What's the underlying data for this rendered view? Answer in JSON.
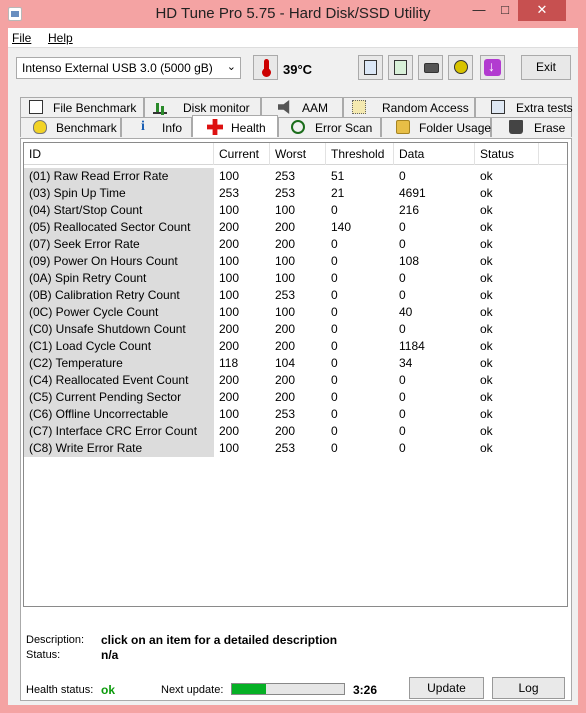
{
  "window": {
    "title": "HD Tune Pro 5.75 - Hard Disk/SSD Utility"
  },
  "menu": {
    "file": "File",
    "help": "Help"
  },
  "toolbar": {
    "drive": "Intenso External USB 3.0 (5000 gB)",
    "temperature": "39°C",
    "exit_label": "Exit"
  },
  "tabs_top": [
    {
      "label": "File Benchmark",
      "icon": "document-icon"
    },
    {
      "label": "Disk monitor",
      "icon": "bar-chart-icon"
    },
    {
      "label": "AAM",
      "icon": "speaker-icon"
    },
    {
      "label": "Random Access",
      "icon": "grid-icon"
    },
    {
      "label": "Extra tests",
      "icon": "table-icon"
    }
  ],
  "tabs_bottom": [
    {
      "label": "Benchmark",
      "icon": "bulb-icon"
    },
    {
      "label": "Info",
      "icon": "info-icon"
    },
    {
      "label": "Health",
      "icon": "health-cross-icon",
      "active": true
    },
    {
      "label": "Error Scan",
      "icon": "magnifier-icon"
    },
    {
      "label": "Folder Usage",
      "icon": "folder-icon"
    },
    {
      "label": "Erase",
      "icon": "trash-icon"
    }
  ],
  "smart_table": {
    "columns": [
      "ID",
      "Current",
      "Worst",
      "Threshold",
      "Data",
      "Status"
    ],
    "rows": [
      [
        "(01) Raw Read Error Rate",
        "100",
        "253",
        "51",
        "0",
        "ok"
      ],
      [
        "(03) Spin Up Time",
        "253",
        "253",
        "21",
        "4691",
        "ok"
      ],
      [
        "(04) Start/Stop Count",
        "100",
        "100",
        "0",
        "216",
        "ok"
      ],
      [
        "(05) Reallocated Sector Count",
        "200",
        "200",
        "140",
        "0",
        "ok"
      ],
      [
        "(07) Seek Error Rate",
        "200",
        "200",
        "0",
        "0",
        "ok"
      ],
      [
        "(09) Power On Hours Count",
        "100",
        "100",
        "0",
        "108",
        "ok"
      ],
      [
        "(0A) Spin Retry Count",
        "100",
        "100",
        "0",
        "0",
        "ok"
      ],
      [
        "(0B) Calibration Retry Count",
        "100",
        "253",
        "0",
        "0",
        "ok"
      ],
      [
        "(0C) Power Cycle Count",
        "100",
        "100",
        "0",
        "40",
        "ok"
      ],
      [
        "(C0) Unsafe Shutdown Count",
        "200",
        "200",
        "0",
        "0",
        "ok"
      ],
      [
        "(C1) Load Cycle Count",
        "200",
        "200",
        "0",
        "1184",
        "ok"
      ],
      [
        "(C2) Temperature",
        "118",
        "104",
        "0",
        "34",
        "ok"
      ],
      [
        "(C4) Reallocated Event Count",
        "200",
        "200",
        "0",
        "0",
        "ok"
      ],
      [
        "(C5) Current Pending Sector",
        "200",
        "200",
        "0",
        "0",
        "ok"
      ],
      [
        "(C6) Offline Uncorrectable",
        "100",
        "253",
        "0",
        "0",
        "ok"
      ],
      [
        "(C7) Interface CRC Error Count",
        "200",
        "200",
        "0",
        "0",
        "ok"
      ],
      [
        "(C8) Write Error Rate",
        "100",
        "253",
        "0",
        "0",
        "ok"
      ]
    ]
  },
  "description": {
    "label": "Description:",
    "value": "click on an item for a detailed description"
  },
  "status": {
    "label": "Status:",
    "value": "n/a"
  },
  "footer": {
    "health_label": "Health status:",
    "health_value": "ok",
    "next_update_label": "Next update:",
    "progress": 0.3,
    "timer": "3:26",
    "update_label": "Update",
    "log_label": "Log"
  },
  "colors": {
    "window_frame": "#f4a3a3",
    "health_ok": "#0a9a0a",
    "progress_fill": "#06b025",
    "close_button": "#c75050"
  }
}
